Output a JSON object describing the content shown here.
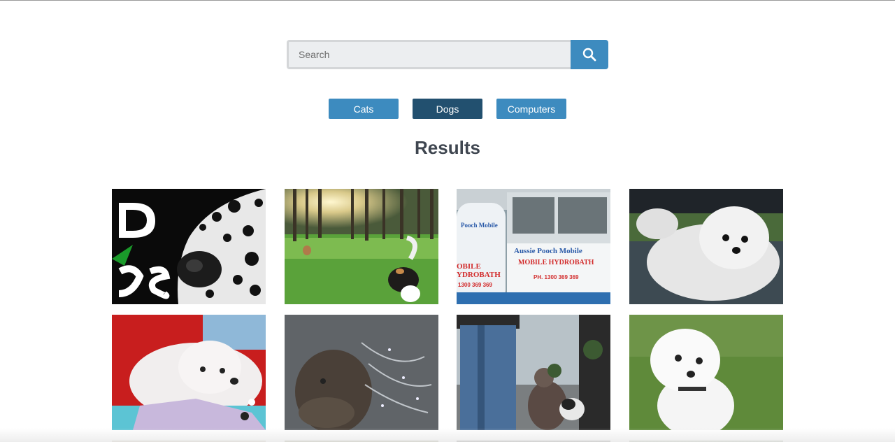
{
  "search": {
    "placeholder": "Search",
    "value": ""
  },
  "categories": [
    {
      "label": "Cats",
      "active": false
    },
    {
      "label": "Dogs",
      "active": true
    },
    {
      "label": "Computers",
      "active": false
    }
  ],
  "results": {
    "title": "Results"
  },
  "colors": {
    "primary": "#3d8bbf",
    "active": "#22506f",
    "heading": "#3f4650"
  },
  "image_tiles": [
    {
      "subject": "dalmatian close-up"
    },
    {
      "subject": "dogs running in field at sunset"
    },
    {
      "subject": "mobile hydrobath trailer"
    },
    {
      "subject": "white fluffy dog"
    },
    {
      "subject": "white dog lying on blanket"
    },
    {
      "subject": "dog shaking off water"
    },
    {
      "subject": "dogs on leash with people"
    },
    {
      "subject": "white poodle on grass"
    }
  ],
  "tile_texts": {
    "trailer_line1": "Aussie Pooch Mobile",
    "trailer_line2": "MOBILE HYDROBATH",
    "trailer_line3": "PH. 1300 369 369",
    "trailer_side1": "Pooch Mobile",
    "trailer_side2": "OBILE",
    "trailer_side3": "YDROBATH",
    "trailer_side4": "1300 369 369"
  }
}
